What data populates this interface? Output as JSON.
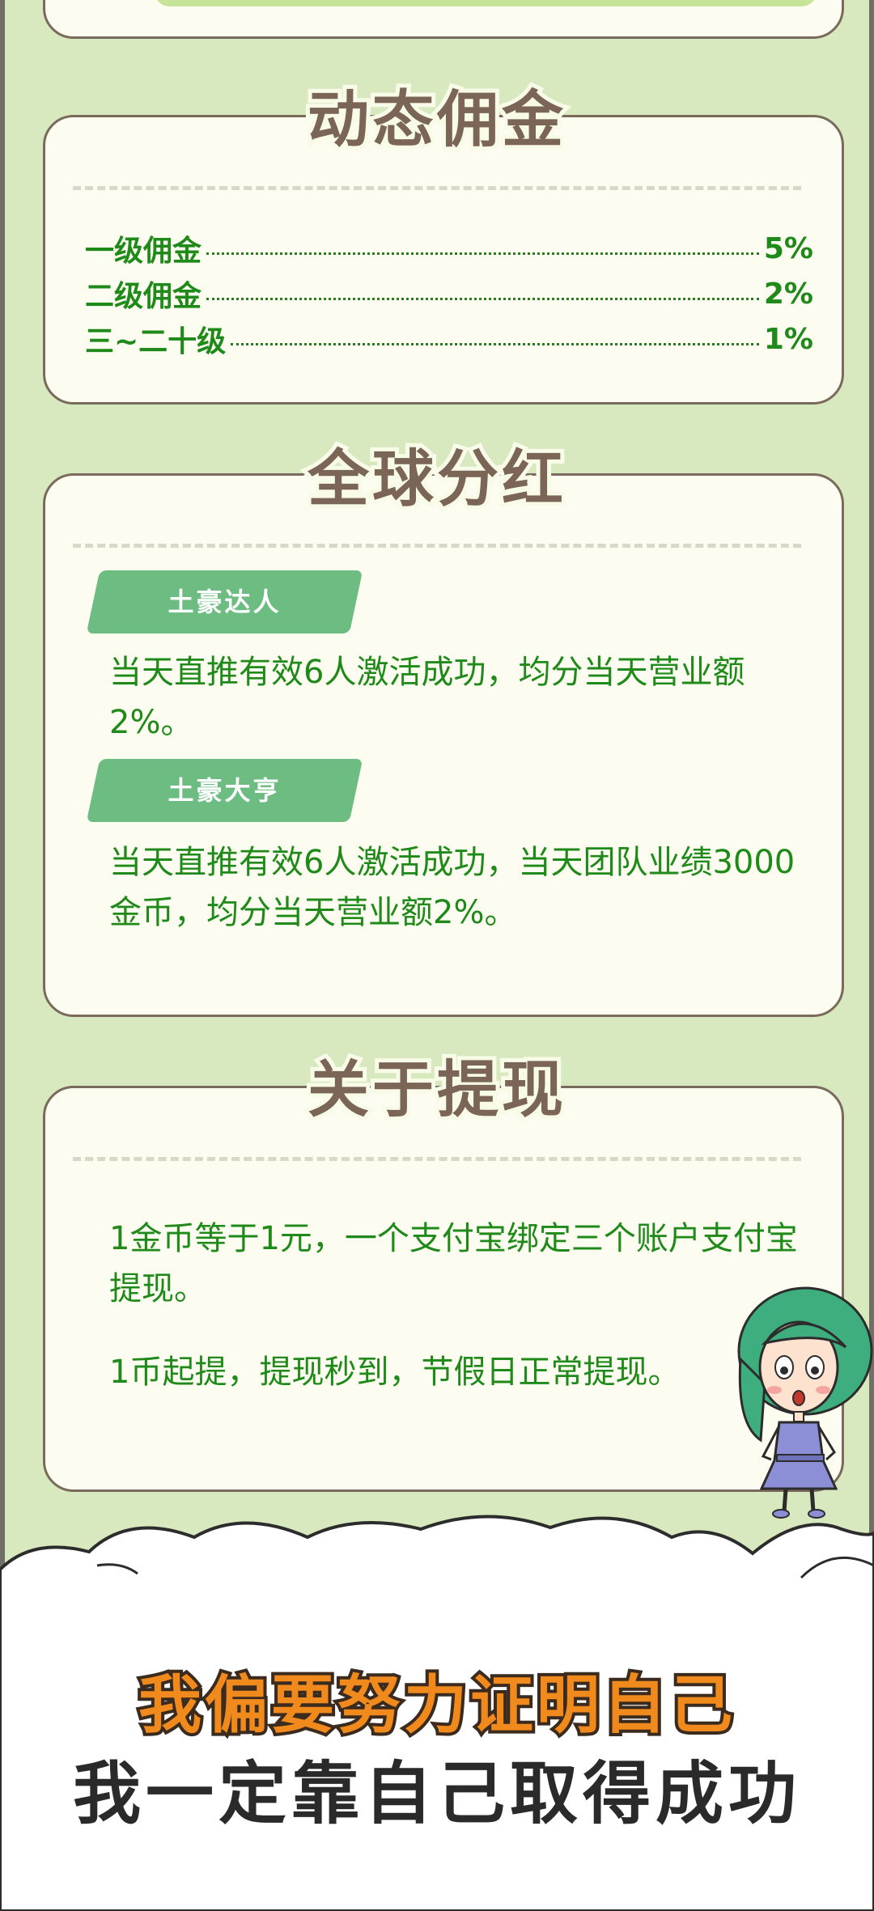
{
  "dynamic_commission": {
    "title": "动态佣金",
    "rows": [
      {
        "label": "一级佣金",
        "value": "5%"
      },
      {
        "label": "二级佣金",
        "value": "2%"
      },
      {
        "label": "三~二十级",
        "value": "1%"
      }
    ]
  },
  "global_dividend": {
    "title": "全球分红",
    "items": [
      {
        "tag": "土豪达人",
        "text": "当天直推有效6人激活成功，均分当天营业额2%。"
      },
      {
        "tag": "土豪大亨",
        "text": "当天直推有效6人激活成功，当天团队业绩3000金币，均分当天营业额2%。"
      }
    ]
  },
  "withdrawal": {
    "title": "关于提现",
    "paragraphs": [
      "1金币等于1元，一个支付宝绑定三个账户支付宝提现。",
      "1币起提，提现秒到，节假日正常提现。"
    ]
  },
  "slogans": {
    "line1": "我偏要努力证明自己",
    "line2": "我一定靠自己取得成功"
  },
  "colors": {
    "background": "#d9e9bf",
    "card": "#fcfdf0",
    "title": "#7a6557",
    "text_green": "#1f8a1a",
    "tag_green": "#6dbd83",
    "slogan_orange": "#f08a1c"
  }
}
